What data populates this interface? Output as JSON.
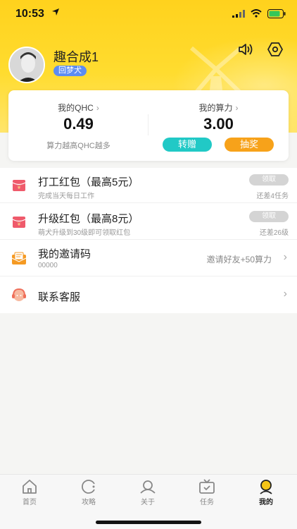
{
  "status_bar": {
    "time": "10:53"
  },
  "profile": {
    "name": "趣合成1",
    "level": "回梦犬"
  },
  "stats": {
    "qhc": {
      "title": "我的QHC",
      "value": "0.49",
      "note": "算力越高QHC越多"
    },
    "power": {
      "title": "我的算力",
      "value": "3.00",
      "transfer_label": "转赠",
      "lottery_label": "抽奖"
    }
  },
  "list": {
    "work_packet": {
      "title": "打工红包（最高5元）",
      "subtitle": "完成当天每日工作",
      "button": "领取",
      "hint": "还差4任务"
    },
    "upgrade_packet": {
      "title": "升级红包（最高8元）",
      "subtitle": "萌犬升级到30级即可领取红包",
      "button": "领取",
      "hint": "还差26级"
    },
    "invite": {
      "title": "我的邀请码",
      "subtitle": "00000",
      "right_text": "邀请好友+50算力"
    },
    "service": {
      "title": "联系客服"
    }
  },
  "tabbar": {
    "items": [
      {
        "label": "首页",
        "icon": "home-icon"
      },
      {
        "label": "攻略",
        "icon": "guide-icon"
      },
      {
        "label": "关于",
        "icon": "about-icon"
      },
      {
        "label": "任务",
        "icon": "task-icon"
      },
      {
        "label": "我的",
        "icon": "profile-icon"
      }
    ],
    "active": "我的"
  },
  "colors": {
    "accent_yellow": "#ffd21d",
    "teal": "#21c9c6",
    "orange": "#f7a21a",
    "badge_blue": "#5c8cf2"
  }
}
